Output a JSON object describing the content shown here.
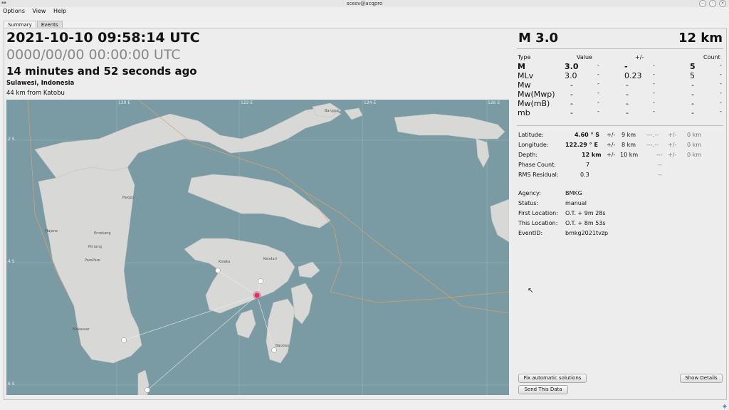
{
  "window": {
    "title": "scesv@acqpro"
  },
  "menu": [
    "Options",
    "View",
    "Help"
  ],
  "tabs": [
    "Summary",
    "Events"
  ],
  "event": {
    "origin_time": "2021-10-10 09:58:14 UTC",
    "second_time": "0000/00/00  00:00:00 UTC",
    "time_ago": "14 minutes and 52 seconds ago",
    "region": "Sulawesi, Indonesia",
    "nearest": "44 km from Katobu",
    "magnitude": "M 3.0",
    "depth": "12 km"
  },
  "magnitudes": {
    "headers": {
      "type": "Type",
      "value": "Value",
      "pm": "+/-",
      "count": "Count"
    },
    "rows": [
      {
        "type": "M",
        "value": "3.0",
        "d1": "-",
        "pm": "-",
        "d2": "-",
        "count": "5",
        "d3": "-"
      },
      {
        "type": "MLv",
        "value": "3.0",
        "d1": "-",
        "pm": "0.23",
        "d2": "-",
        "count": "5",
        "d3": "-"
      },
      {
        "type": "Mw",
        "value": "-",
        "d1": "-",
        "pm": "-",
        "d2": "-",
        "count": "-",
        "d3": "-"
      },
      {
        "type": "Mw(Mwp)",
        "value": "-",
        "d1": "-",
        "pm": "-",
        "d2": "-",
        "count": "-",
        "d3": "-"
      },
      {
        "type": "Mw(mB)",
        "value": "-",
        "d1": "-",
        "pm": "-",
        "d2": "-",
        "count": "-",
        "d3": "-"
      },
      {
        "type": "mb",
        "value": "-",
        "d1": "-",
        "pm": "-",
        "d2": "-",
        "count": "-",
        "d3": "-"
      }
    ]
  },
  "location": {
    "latitude_label": "Latitude:",
    "latitude": "4.60 ° S",
    "lat_pm": "+/-",
    "lat_unc": "9 km",
    "lat_alt": "---.--",
    "lat_alt_pm": "+/-",
    "lat_alt_unc": "0 km",
    "longitude_label": "Longitude:",
    "longitude": "122.29 ° E",
    "lon_pm": "+/-",
    "lon_unc": "8 km",
    "lon_alt": "---.--",
    "lon_alt_pm": "+/-",
    "lon_alt_unc": "0 km",
    "depth_label": "Depth:",
    "depth": "12 km",
    "dep_pm": "+/-",
    "dep_unc": "10 km",
    "dep_alt": "---",
    "dep_alt_pm": "+/-",
    "dep_alt_unc": "0 km",
    "phase_label": "Phase Count:",
    "phase": "7",
    "phase_alt": "--",
    "rms_label": "RMS Residual:",
    "rms": "0.3",
    "rms_alt": "--"
  },
  "details": {
    "agency_label": "Agency:",
    "agency": "BMKG",
    "status_label": "Status:",
    "status": "manual",
    "first_label": "First Location:",
    "first": "O.T. + 9m 28s",
    "this_label": "This Location:",
    "this": "O.T. + 8m 53s",
    "eventid_label": "EventID:",
    "eventid": "bmkg2021tvzp"
  },
  "buttons": {
    "fix": "Fix automatic solutions",
    "send": "Send This Data",
    "show": "Show Details"
  },
  "map": {
    "lon_labels": [
      "120 E",
      "122 E",
      "124 E",
      "126 E"
    ],
    "lat_labels": [
      "2 S",
      "4 S",
      "6 S"
    ],
    "places": [
      "Banggai",
      "Palopo",
      "Majene",
      "Enrekang",
      "Pinrang",
      "ParePare",
      "Kolaka",
      "Kendari",
      "Makassar",
      "Baubau"
    ],
    "colors": {
      "sea": "#7a9ba3",
      "land": "#d8d8d6",
      "border": "#d9a46a",
      "event": "#e0306a"
    }
  }
}
